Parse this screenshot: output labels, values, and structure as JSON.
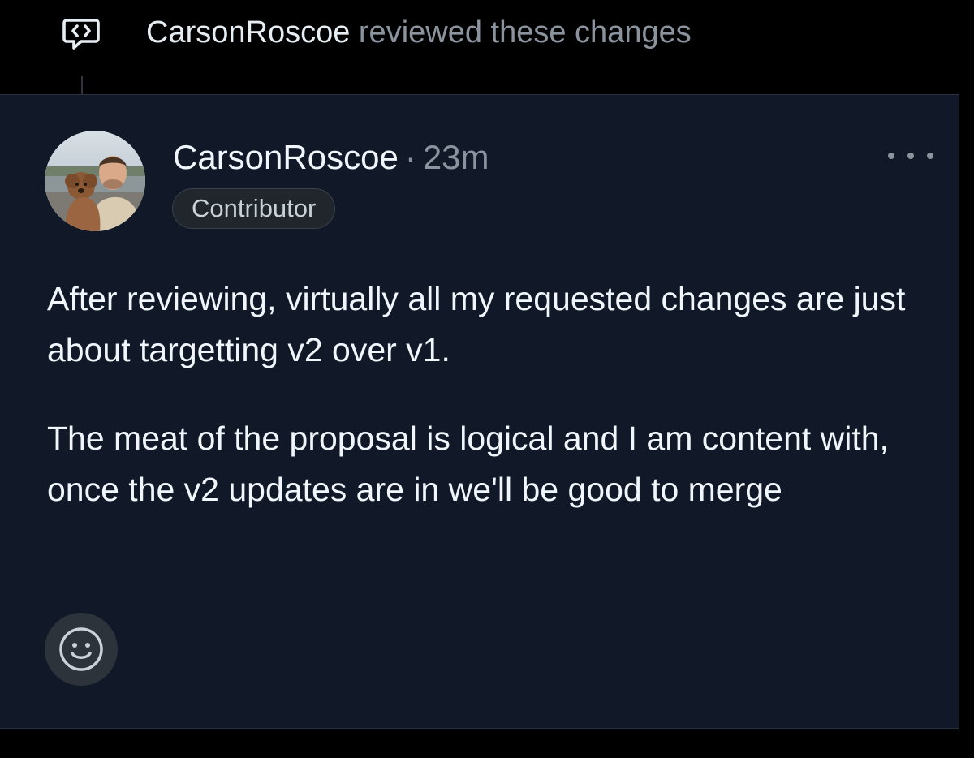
{
  "timeline": {
    "actor": "CarsonRoscoe",
    "action": " reviewed these changes",
    "icon": "code-review-icon"
  },
  "comment": {
    "author": "CarsonRoscoe",
    "separator": "·",
    "timestamp": "23m",
    "role_badge": "Contributor",
    "more_icon": "kebab-horizontal-icon",
    "paragraphs": [
      "After reviewing, virtually all my requested changes are just about targetting v2 over v1.",
      "The meat of the proposal is logical and I am content with, once the v2 updates are in we'll be good to merge"
    ],
    "reaction_icon": "smiley-icon"
  },
  "colors": {
    "background": "#000000",
    "card": "#111827",
    "text_primary": "#f0f6fc",
    "text_muted": "#8b949e"
  }
}
